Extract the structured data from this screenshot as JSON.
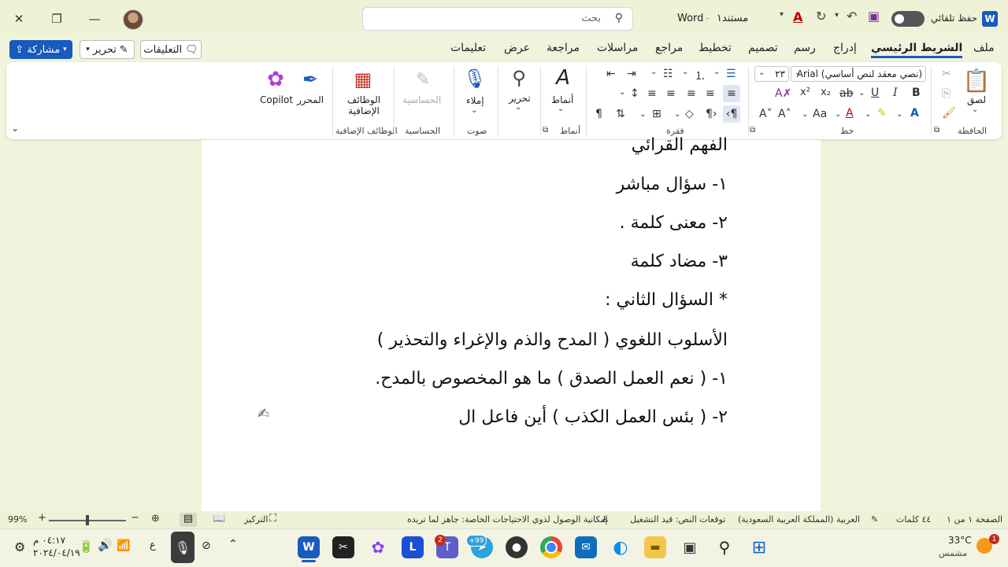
{
  "window": {
    "doc_name": "مستند١",
    "app_name": "Word",
    "autosave_label": "حفظ تلقائي",
    "search_placeholder": "بحث"
  },
  "menu": [
    "ملف",
    "الشريط الرئيسي",
    "إدراج",
    "رسم",
    "تصميم",
    "تخطيط",
    "مراجع",
    "مراسلات",
    "مراجعة",
    "عرض",
    "تعليمات"
  ],
  "menu_active_index": 1,
  "top_buttons": {
    "comments": "التعليقات",
    "editing": "تحرير",
    "share": "مشاركة"
  },
  "ribbon": {
    "clipboard": {
      "paste": "لصق",
      "group": "الحافظة"
    },
    "font": {
      "name": "Arial (نصي معقد لنص أساسي)",
      "size": "٢٣",
      "group": "خط"
    },
    "paragraph": {
      "group": "فقرة"
    },
    "styles": {
      "label": "أنماط",
      "group": "أنماط"
    },
    "editing": {
      "label": "تحرير"
    },
    "voice": {
      "label": "إملاء",
      "group": "صوت"
    },
    "sensitivity": {
      "label": "الحساسية",
      "group": "الحساسية"
    },
    "addins": {
      "label": "الوظائف الإضافية",
      "group": "الوظائف الإضافية"
    },
    "editor": {
      "label": "المحرر"
    },
    "copilot": {
      "label": "Copilot"
    }
  },
  "document": {
    "lines": [
      "الفهم القرائي",
      "١- سؤال مباشر",
      "٢- معنى كلمة .",
      "٣- مضاد كلمة",
      "* السؤال الثاني :",
      "الأسلوب اللغوي ( المدح والذم والإغراء والتحذير )",
      "١- ( نعم العمل الصدق ) ما هو المخصوص بالمدح.",
      "٢- ( بئس العمل الكذب ) أين فاعل ال"
    ]
  },
  "status": {
    "page": "الصفحة ١ من ١",
    "words": "٤٤ كلمات",
    "language": "العربية (المملكة العربية السعودية)",
    "predictions": "توقعات النص: قيد التشغيل",
    "accessibility": "إمكانية الوصول لذوي الاحتياجات الخاصة: جاهز لما تريده",
    "focus": "التركيز",
    "zoom": "99%"
  },
  "taskbar": {
    "weather_temp": "33°C",
    "weather_desc": "مشمس",
    "time": "٠٤:١٧ م",
    "date": "٢٠٢٤/٠٤/١٩",
    "lang": "ع",
    "badge_teams": "2",
    "badge_telegram": "+99",
    "badge_weather": "1"
  },
  "colors": {
    "accent": "#185abd",
    "window_bg": "#f0f4dc",
    "page": "#ffffff"
  }
}
